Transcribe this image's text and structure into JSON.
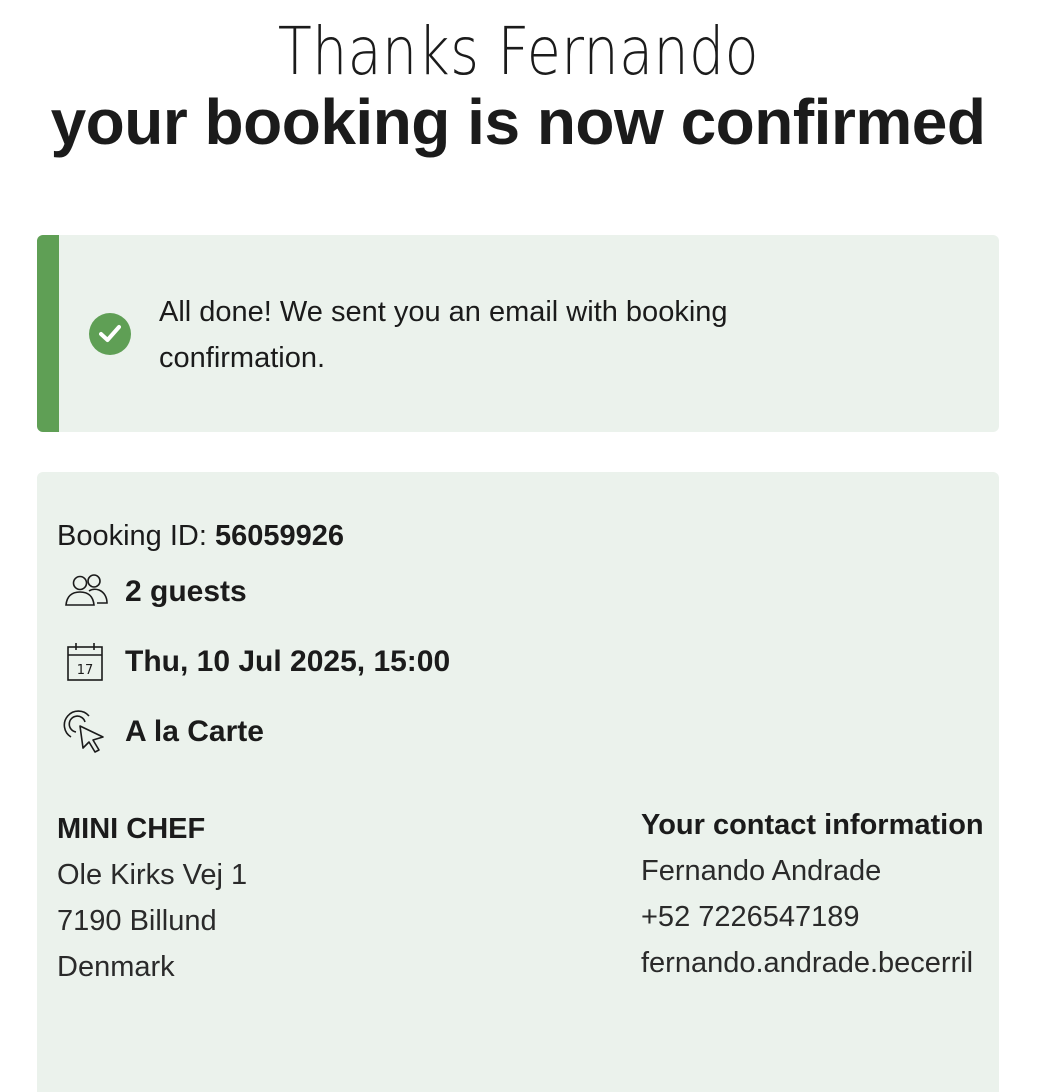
{
  "header": {
    "thanks": "Thanks Fernando",
    "confirmed": "your booking is now confirmed"
  },
  "notice": {
    "icon": "check-circle-icon",
    "message": "All done! We sent you an email with booking confirmation.",
    "accent_color": "#5f9f55",
    "background_color": "#ebf2ec"
  },
  "booking": {
    "id_label": "Booking ID:",
    "id_value": "56059926",
    "guests": {
      "icon": "guests-icon",
      "text": "2 guests"
    },
    "datetime": {
      "icon": "calendar-icon",
      "text": "Thu, 10 Jul 2025, 15:00"
    },
    "menu": {
      "icon": "cursor-click-icon",
      "text": "A la Carte"
    }
  },
  "venue": {
    "name": "MINI CHEF",
    "address_line1": "Ole Kirks Vej 1",
    "address_line2": "7190 Billund",
    "country": "Denmark"
  },
  "contact": {
    "title": "Your contact information",
    "name": "Fernando Andrade",
    "phone": "+52 7226547189",
    "email": "fernando.andrade.becerril"
  }
}
